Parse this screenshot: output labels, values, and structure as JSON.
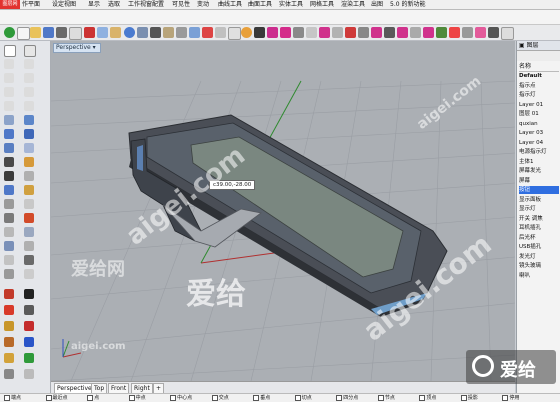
{
  "menubar": {
    "badge": "图层网",
    "items": [
      "作平面",
      "设定视图",
      "显示",
      "选取",
      "工作视窗配置",
      "可见性",
      "变动",
      "曲线工具",
      "曲面工具",
      "实体工具",
      "网格工具",
      "渲染工具",
      "出图",
      "5.0 的新功能"
    ]
  },
  "viewport": {
    "title": "Perspective",
    "coord_readout": "c39.00,-28.00"
  },
  "viewport_tabs": [
    "Perspective",
    "Top",
    "Front",
    "Right"
  ],
  "osnap": {
    "items": [
      "端点",
      "最近点",
      "点",
      "中点",
      "中心点",
      "交点",
      "垂点",
      "切点",
      "四分点",
      "节点",
      "顶点",
      "投影",
      "停用"
    ]
  },
  "layers": {
    "panel_title": "图层",
    "column_name": "名称",
    "items": [
      "Default",
      "指示点",
      "指示灯",
      "Layer 01",
      "图层 01",
      "quxian",
      "Layer 03",
      "Layer 04",
      "电源指示灯",
      "主体1",
      "屏幕发光",
      "屏幕",
      "按钮",
      "显示面板",
      "显示灯",
      "开关 调焦",
      "耳机插孔",
      "后光杯",
      "USB插孔",
      "发光灯",
      "镜头玻璃",
      "喇叭"
    ],
    "selected_index": 12
  },
  "watermarks": {
    "site": "aigei.com",
    "brand": "爱给",
    "brand_cn": "爱给网"
  },
  "colors": {
    "viewport_bg": "#abafb4",
    "grid": "#9a9ea4",
    "selection": "#2f6ee0",
    "x_axis": "#b03030",
    "y_axis": "#2f8a2f",
    "z_axis": "#3050c0"
  }
}
